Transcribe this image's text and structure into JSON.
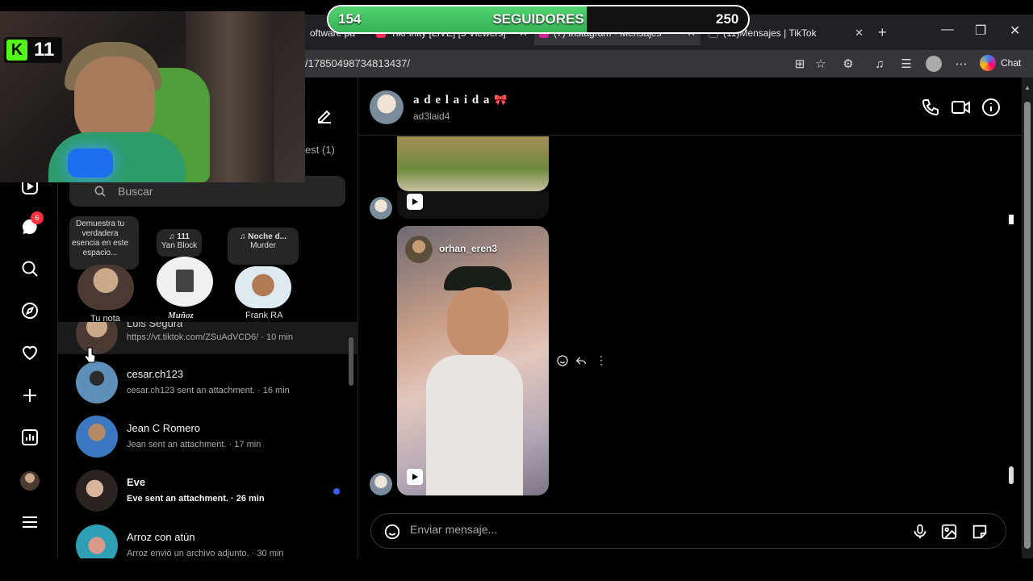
{
  "browser": {
    "tabs": [
      {
        "label": "oftware pa",
        "color": "#3a3a3a"
      },
      {
        "label": "TikFinity [LIVE] [5 Viewers]",
        "color": "#fe2c55"
      },
      {
        "label": "(7) Instagram • Mensajes",
        "color": "#d6249f"
      },
      {
        "label": "(11)Mensajes | TikTok",
        "color": "#222222"
      }
    ],
    "new_tab": "+",
    "url": "/17850498734813437/",
    "copilot_label": "Chat"
  },
  "overlay": {
    "followers_current": "154",
    "followers_label": "SEGUIDORES",
    "followers_goal": "250",
    "followers_fraction": 0.616,
    "kick_count": "11"
  },
  "sidebar": {
    "notification_badge": "6"
  },
  "inbox": {
    "requests_label": "est (1)",
    "search_placeholder": "Buscar",
    "notes": [
      {
        "text": "Demuestra tu verdadera esencia en este espacio...",
        "label": "Tu nota"
      },
      {
        "song": "111",
        "artist": "Yan Block",
        "label": "Muñoz"
      },
      {
        "song": "Noche d...",
        "artist": "Murder",
        "label": "Frank RA"
      }
    ],
    "threads": [
      {
        "name": "Luis Segura",
        "preview": "https://vt.tiktok.com/ZSuAdVCD6/ · 10 min",
        "bold": false
      },
      {
        "name": "cesar.ch123",
        "preview": "cesar.ch123 sent an attachment. · 16 min",
        "bold": false
      },
      {
        "name": "Jean C Romero",
        "preview": "Jean sent an attachment. · 17 min",
        "bold": false
      },
      {
        "name": "Eve",
        "preview": "Eve sent an attachment. · 26 min",
        "bold": true
      },
      {
        "name": "Arroz con atún",
        "preview": "Arroz envió un archivo adjunto. · 30 min",
        "bold": false
      }
    ]
  },
  "chat": {
    "title": "a d e l a i d a",
    "username": "ad3laid4",
    "reel_author": "orhan_eren3",
    "composer_placeholder": "Enviar mensaje..."
  },
  "colors": {
    "accent_blue": "#3a5af9",
    "follower_bar": "#4cc764",
    "kick_green": "#53fc18"
  }
}
